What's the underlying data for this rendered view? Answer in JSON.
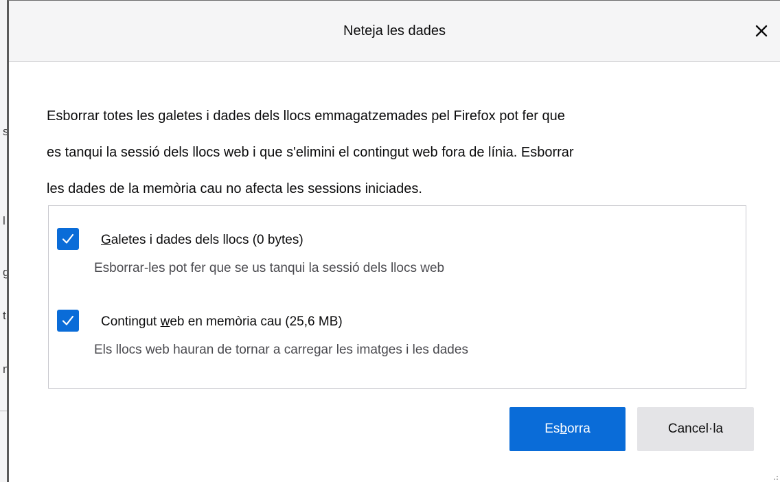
{
  "underlay": {
    "fragments": [
      "s",
      "l",
      "g",
      "t",
      "n"
    ]
  },
  "dialog": {
    "title": "Neteja les dades",
    "close_icon": "close-icon",
    "description_lines": [
      "Esborrar totes les galetes i dades dels llocs emmagatzemades pel Firefox pot fer que",
      "es tanqui la sessió dels llocs web i que s'elimini el contingut web fora de línia. Esborrar",
      "les dades de la memòria cau no afecta les sessions iniciades."
    ],
    "options": [
      {
        "checked": true,
        "label_pre": "",
        "label_access": "G",
        "label_post": "aletes i dades dels llocs (0 bytes)",
        "description": "Esborrar-les pot fer que se us tanqui la sessió dels llocs web"
      },
      {
        "checked": true,
        "label_pre": "Contingut ",
        "label_access": "w",
        "label_post": "eb en memòria cau (25,6 MB)",
        "description": "Els llocs web hauran de tornar a carregar les imatges i les dades"
      }
    ],
    "buttons": {
      "clear_pre": "Es",
      "clear_access": "b",
      "clear_post": "orra",
      "cancel": "Cancel·la"
    },
    "colors": {
      "accent": "#0a6cd8",
      "secondary_button": "#e4e4e7",
      "titlebar": "#f5f5f6"
    }
  }
}
